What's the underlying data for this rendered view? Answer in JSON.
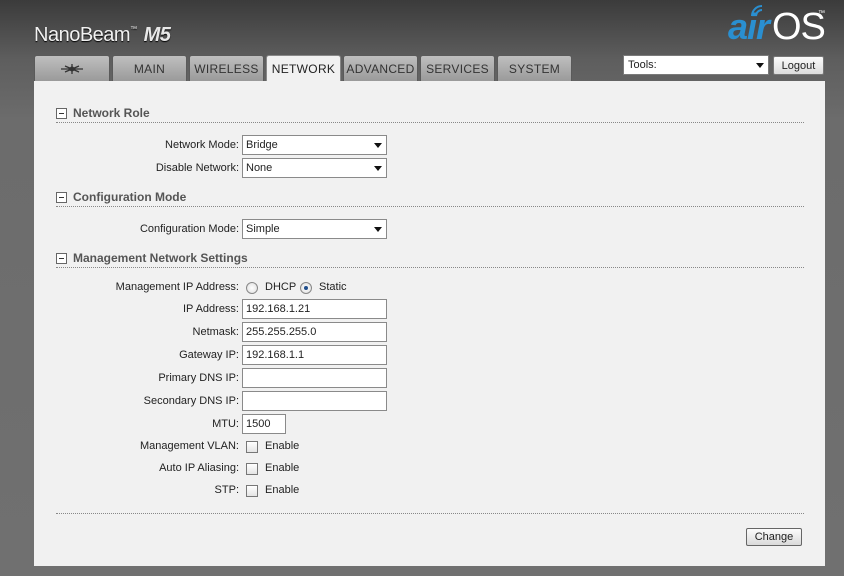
{
  "header": {
    "brand_name": "NanoBeam",
    "brand_model": "M5",
    "trademark": "™",
    "logo_air": "air",
    "logo_os": "OS",
    "logo_tm": "™"
  },
  "tabs": [
    {
      "label": "",
      "icon": "ubiquiti-logo-icon",
      "active": false
    },
    {
      "label": "MAIN",
      "active": false
    },
    {
      "label": "WIRELESS",
      "active": false
    },
    {
      "label": "NETWORK",
      "active": true
    },
    {
      "label": "ADVANCED",
      "active": false
    },
    {
      "label": "SERVICES",
      "active": false
    },
    {
      "label": "SYSTEM",
      "active": false
    }
  ],
  "toolbar": {
    "tools_value": "Tools:",
    "logout_label": "Logout"
  },
  "network_role": {
    "title": "Network Role",
    "network_mode_label": "Network Mode:",
    "network_mode_value": "Bridge",
    "disable_network_label": "Disable Network:",
    "disable_network_value": "None"
  },
  "configuration_mode": {
    "title": "Configuration Mode",
    "config_mode_label": "Configuration Mode:",
    "config_mode_value": "Simple"
  },
  "management": {
    "title": "Management Network Settings",
    "mgmt_ip_label": "Management IP Address:",
    "dhcp_label": "DHCP",
    "static_label": "Static",
    "selected": "Static",
    "ip_label": "IP Address:",
    "ip_value": "192.168.1.21",
    "netmask_label": "Netmask:",
    "netmask_value": "255.255.255.0",
    "gateway_label": "Gateway IP:",
    "gateway_value": "192.168.1.1",
    "primary_dns_label": "Primary DNS IP:",
    "primary_dns_value": "",
    "secondary_dns_label": "Secondary DNS IP:",
    "secondary_dns_value": "",
    "mtu_label": "MTU:",
    "mtu_value": "1500",
    "vlan_label": "Management VLAN:",
    "vlan_enable": "Enable",
    "alias_label": "Auto IP Aliasing:",
    "alias_enable": "Enable",
    "stp_label": "STP:",
    "stp_enable": "Enable"
  },
  "footer": {
    "change_label": "Change"
  }
}
